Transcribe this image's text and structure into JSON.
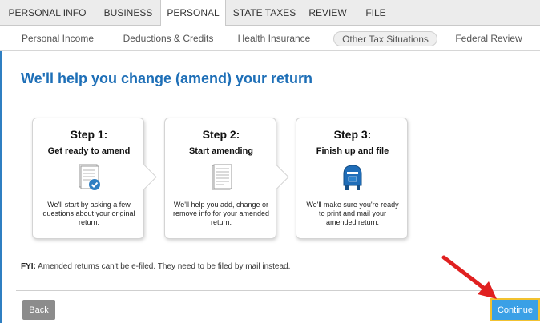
{
  "top_tabs": [
    "PERSONAL INFO",
    "BUSINESS",
    "PERSONAL",
    "STATE TAXES",
    "REVIEW",
    "FILE"
  ],
  "sub_nav": [
    "Personal Income",
    "Deductions & Credits",
    "Health Insurance",
    "Other Tax Situations",
    "Federal Review"
  ],
  "page_title": "We'll help you change (amend) your return",
  "steps": [
    {
      "label": "Step 1:",
      "title": "Get ready to amend",
      "description": "We'll start by asking a few questions about your original return.",
      "icon": "document-check-icon"
    },
    {
      "label": "Step 2:",
      "title": "Start amending",
      "description": "We'll help you add, change or remove info for your amended return.",
      "icon": "document-icon"
    },
    {
      "label": "Step 3:",
      "title": "Finish up and file",
      "description": "We'll make sure you're ready to print and mail your amended return.",
      "icon": "mailbox-icon"
    }
  ],
  "fyi": {
    "label": "FYI:",
    "text": "Amended returns can't be e-filed. They need to be filed by mail instead."
  },
  "buttons": {
    "back": "Back",
    "continue": "Continue"
  },
  "colors": {
    "accent": "#1e6fb7",
    "continue_bg": "#3aa0e6",
    "continue_border": "#f2c230",
    "annotation_arrow": "#e02020"
  }
}
